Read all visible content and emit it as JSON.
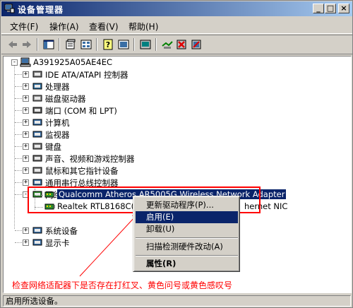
{
  "window": {
    "title": "设备管理器"
  },
  "caption_buttons": {
    "minimize": "_",
    "maximize": "□",
    "close": "×"
  },
  "menu": [
    "文件(F)",
    "操作(A)",
    "查看(V)",
    "帮助(H)"
  ],
  "toolbar_icons": [
    "back-arrow-icon",
    "forward-arrow-icon",
    "console-tree-icon",
    "properties-icon",
    "help-icon",
    "view-icon",
    "print-icon",
    "scan-hardware-icon",
    "uninstall-icon",
    "disable-icon"
  ],
  "tree": {
    "root": "A391925A05AE4EC",
    "categories": [
      "IDE ATA/ATAPI 控制器",
      "处理器",
      "磁盘驱动器",
      "端口 (COM 和 LPT)",
      "计算机",
      "监视器",
      "键盘",
      "声音、视频和游戏控制器",
      "鼠标和其它指针设备",
      "通用串行总线控制器",
      "网络适配器",
      "系统设备",
      "显示卡"
    ],
    "network_children": [
      "Qualcomm Atheros AR5005G Wireless Network Adapter",
      "Realtek RTL8168C(P"
    ],
    "network_child2_tail": "hernet NIC"
  },
  "context_menu": {
    "items": [
      "更新驱动程序(P)...",
      "启用(E)",
      "卸载(U)",
      "扫描检测硬件改动(A)",
      "属性(R)"
    ]
  },
  "annotation": "检查网络适配器下是否存在打红叉、黄色问号或黄色感叹号",
  "status": "启用所选设备。",
  "colors": {
    "title_start": "#0a246a",
    "title_end": "#a6caf0",
    "selection": "#0a246a",
    "annotation": "#ff0000"
  }
}
